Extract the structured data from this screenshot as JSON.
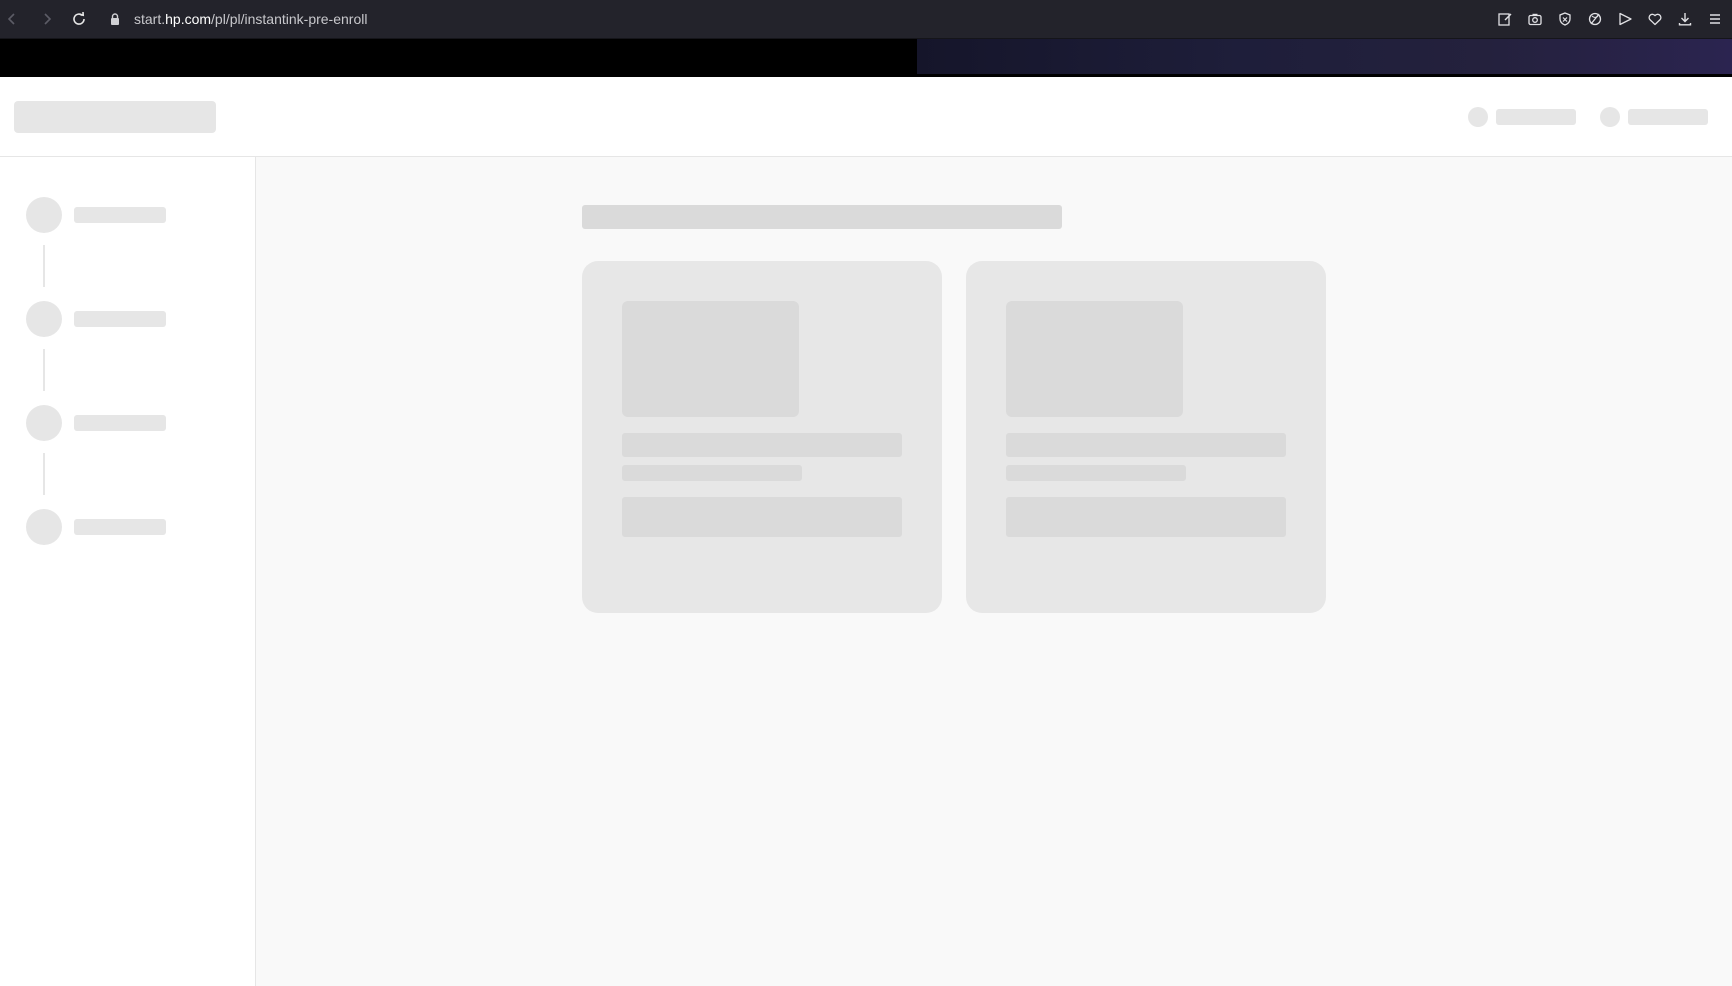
{
  "browser": {
    "url_prefix": "start.",
    "url_host": "hp.com",
    "url_path": "/pl/pl/instantink-pre-enroll",
    "toolbar_icons": [
      "edit-icon",
      "camera-icon",
      "shield-icon",
      "vpn-icon",
      "send-icon",
      "heart-icon",
      "download-icon",
      "menu-icon"
    ]
  },
  "page": {
    "state": "loading-skeleton",
    "stepper_steps": 4,
    "cards": 2
  },
  "colors": {
    "browser_bar": "#23232b",
    "skeleton": "#e6e6e6",
    "skeleton_dark": "#dadada",
    "page_bg": "#f9f9f9"
  }
}
